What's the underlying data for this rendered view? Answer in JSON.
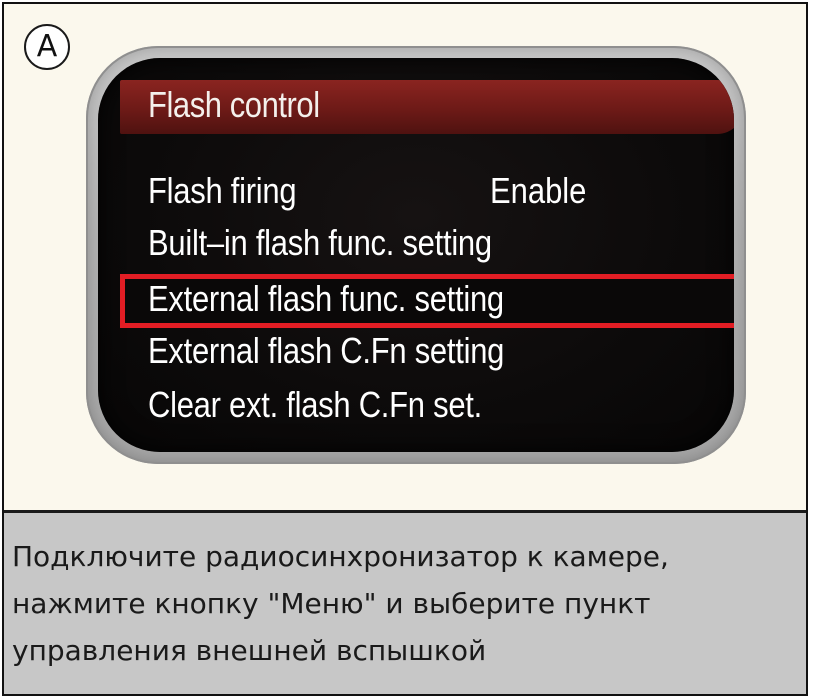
{
  "badge": {
    "letter": "A"
  },
  "menu": {
    "title": "Flash control",
    "items": [
      {
        "label": "Flash firing",
        "value": "Enable",
        "selected": false
      },
      {
        "label": "Built–in flash func. setting",
        "value": "",
        "selected": false
      },
      {
        "label": "External flash func. setting",
        "value": "",
        "selected": true
      },
      {
        "label": "External flash C.Fn setting",
        "value": "",
        "selected": false
      },
      {
        "label": "Clear ext. flash C.Fn set.",
        "value": "",
        "selected": false
      }
    ],
    "highlight_color": "#e21d24",
    "header_color": "#6d1a17"
  },
  "caption": {
    "lines": [
      "Подключите радиосинхронизатор к камере,",
      "нажмите кнопку \"Меню\" и выберите пункт",
      "управления внешней вспышкой"
    ]
  }
}
